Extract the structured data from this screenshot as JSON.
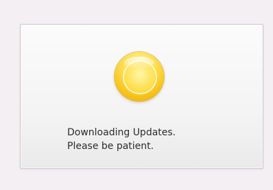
{
  "dialog": {
    "message_line_1": "Downloading Updates.",
    "message_line_2": "Please be patient.",
    "indicator_icon": "status-light-icon",
    "indicator_color": "#f7c21a"
  }
}
